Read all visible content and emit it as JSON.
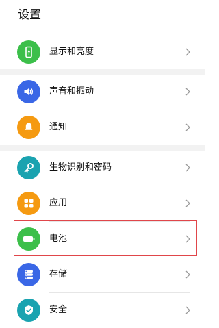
{
  "page": {
    "title": "设置"
  },
  "colors": {
    "display": "#3cbf4a",
    "sound": "#3a67e6",
    "notifications": "#f59a11",
    "biometrics": "#1aa3b0",
    "apps": "#f59a11",
    "battery": "#3cbf4a",
    "storage": "#3a67e6",
    "security": "#1aa3b0",
    "highlight": "#e0464a"
  },
  "settings": {
    "items": [
      {
        "label": "显示和亮度",
        "icon": "display-icon"
      },
      {
        "label": "声音和振动",
        "icon": "speaker-icon"
      },
      {
        "label": "通知",
        "icon": "bell-icon"
      },
      {
        "label": "生物识别和密码",
        "icon": "key-icon"
      },
      {
        "label": "应用",
        "icon": "apps-grid-icon"
      },
      {
        "label": "电池",
        "icon": "battery-icon"
      },
      {
        "label": "存储",
        "icon": "storage-icon"
      },
      {
        "label": "安全",
        "icon": "shield-check-icon"
      }
    ]
  }
}
